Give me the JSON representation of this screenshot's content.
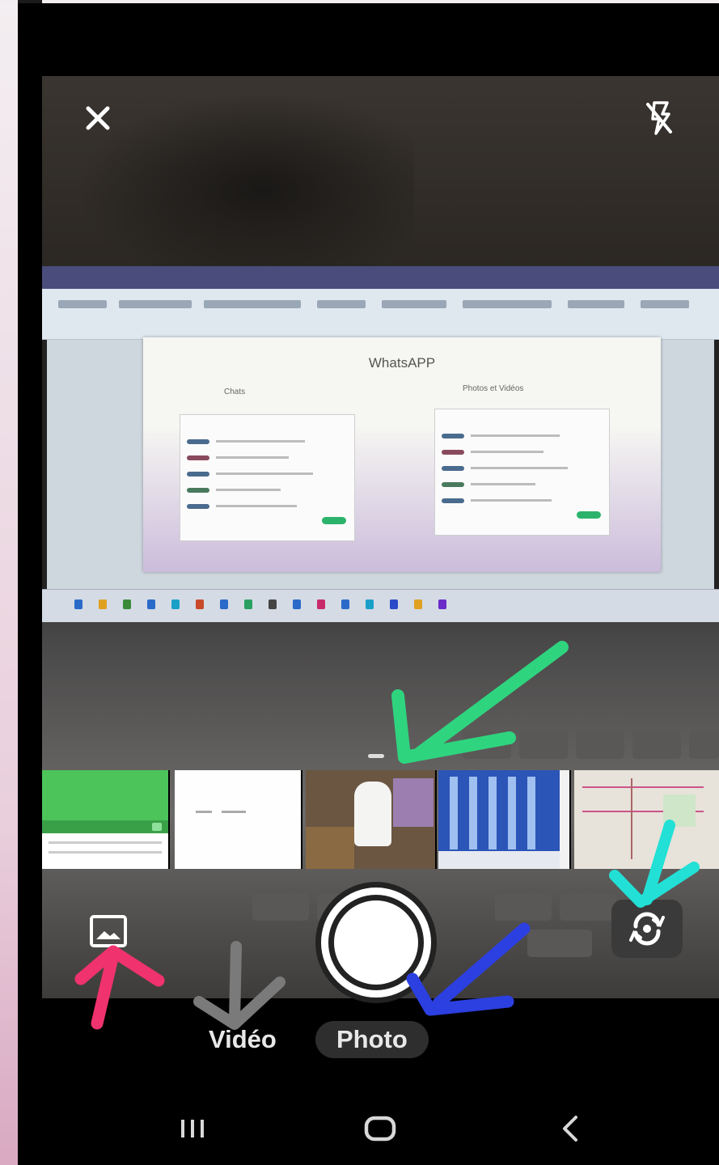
{
  "camera": {
    "close_icon": "close-icon",
    "flash_icon": "flash-off-icon",
    "gallery_icon": "gallery-icon",
    "switch_icon": "switch-camera-icon",
    "shutter_icon": "shutter-button"
  },
  "preview": {
    "doc_title": "WhatsAPP",
    "doc_sub_left": "Chats",
    "doc_sub_right": "Photos et Vidéos"
  },
  "thumbnails": [
    {
      "name": "thumb-green-ui"
    },
    {
      "name": "thumb-white-doc"
    },
    {
      "name": "thumb-person-photo"
    },
    {
      "name": "thumb-blue-bottles"
    },
    {
      "name": "thumb-map-doc"
    }
  ],
  "modes": {
    "video_label": "Vidéo",
    "photo_label": "Photo",
    "selected": "Photo"
  },
  "navbar": {
    "recent_icon": "recents-icon",
    "home_icon": "home-icon",
    "back_icon": "back-icon"
  },
  "colors": {
    "annotation_green": "#2fd47f",
    "annotation_cyan": "#22e0d6",
    "annotation_blue": "#2c3fe0",
    "annotation_pink": "#f0326e",
    "annotation_gray": "#7a7a7a"
  }
}
